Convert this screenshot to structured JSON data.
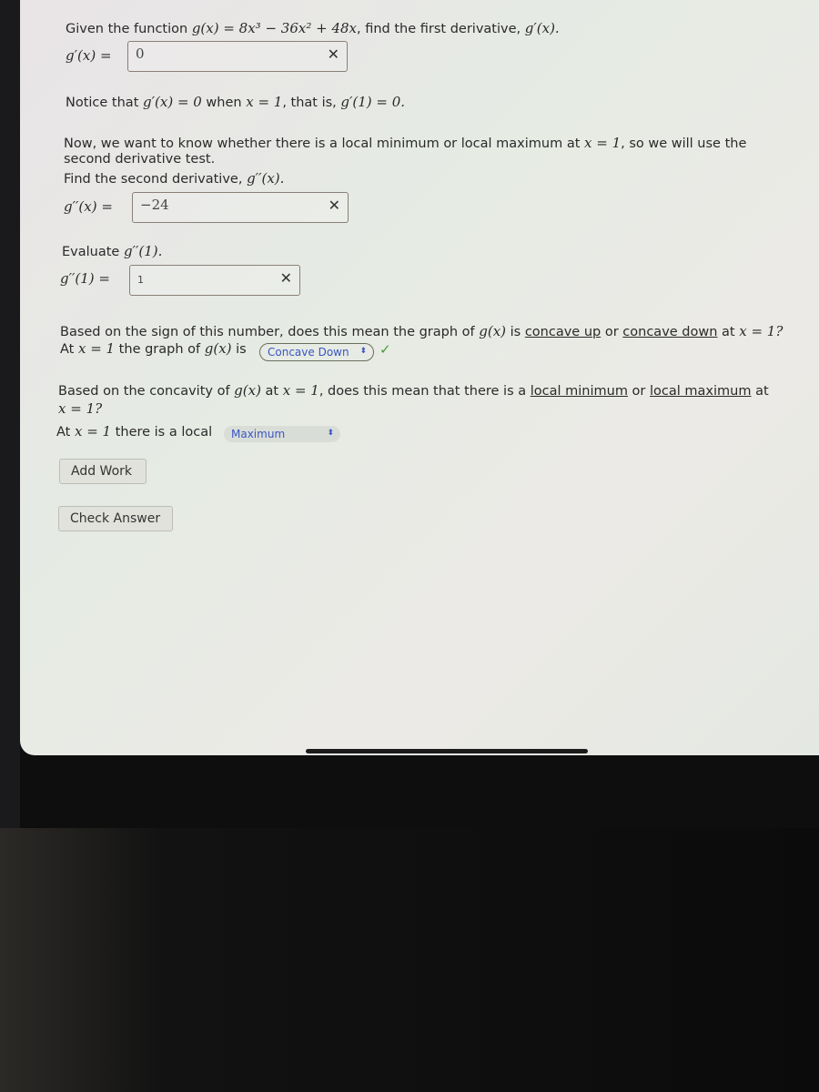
{
  "q1": {
    "prefix": "Given the function ",
    "func": "g(x) = 8x³ − 36x² + 48x",
    "suffix": ", find the first derivative, ",
    "target": "g′(x).",
    "label": "g′(x) =",
    "answer": "0",
    "status": "incorrect"
  },
  "notice": {
    "a": "Notice that ",
    "b": "g′(x) = 0",
    "c": " when ",
    "d": "x = 1",
    "e": ", that is, ",
    "f": "g′(1) = 0."
  },
  "now": {
    "a": "Now, we want to know whether there is a local minimum or local maximum at ",
    "b": "x = 1",
    "c": ", so we will use the",
    "d": "second derivative test."
  },
  "q2": {
    "prompt": "Find the second derivative, ",
    "target": "g′′(x).",
    "label": "g′′(x) =",
    "answer": "−24",
    "status": "incorrect"
  },
  "q3": {
    "prompt": "Evaluate ",
    "target": "g′′(1).",
    "label": "g′′(1) =",
    "answer": "1",
    "status": "incorrect"
  },
  "q4": {
    "a": "Based on the sign of this number, does this mean the graph of ",
    "b": "g(x)",
    "c": " is ",
    "up": "concave up",
    "or": " or ",
    "down": "concave down",
    "d": " at ",
    "e": "x = 1?",
    "l1": "At ",
    "l2": "x = 1",
    "l3": " the graph of ",
    "l4": "g(x)",
    "l5": " is",
    "selected": "Concave Down",
    "status": "correct"
  },
  "q5": {
    "a": "Based on the concavity of ",
    "b": "g(x)",
    "c": " at ",
    "d": "x = 1",
    "e": ", does this mean that there is a ",
    "min": "local minimum",
    "or": " or ",
    "max": "local maximum",
    "f": " at",
    "g": "x = 1?",
    "l1": "At ",
    "l2": "x = 1",
    "l3": " there is a local",
    "selected": "Maximum"
  },
  "buttons": {
    "add_work": "Add Work",
    "check_answer": "Check Answer"
  },
  "colors": {
    "select_text": "#3b55c4",
    "correct": "#4a9a3a"
  },
  "icons": {
    "incorrect": "close-icon",
    "correct": "checkmark-icon",
    "select": "up-down-chevron-icon"
  }
}
